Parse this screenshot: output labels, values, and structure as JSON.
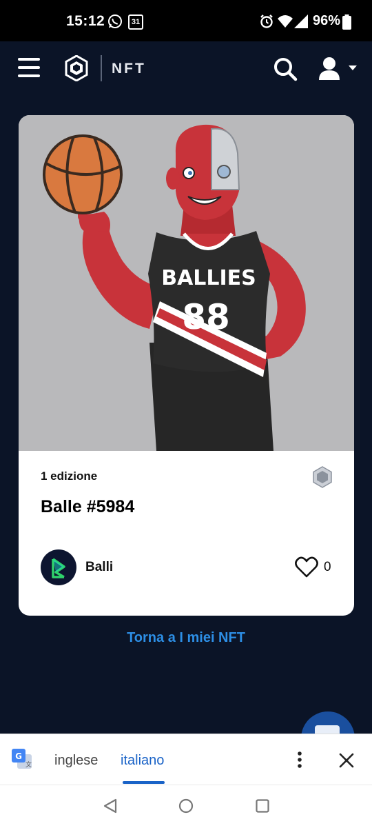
{
  "status_bar": {
    "time": "15:12",
    "calendar_day": "31",
    "battery": "96%"
  },
  "header": {
    "brand": "NFT",
    "icons": [
      "menu-icon",
      "crypto-com-logo",
      "search-icon",
      "account-icon",
      "caret-down-icon"
    ]
  },
  "nft": {
    "jersey_text": "BALLIES",
    "jersey_number": "88",
    "edition": "1 edizione",
    "title": "Balle #5984",
    "creator": "Balli",
    "likes": "0",
    "chain_icon": "hexagon-chain-icon"
  },
  "back_link": "Torna a I miei NFT",
  "translate_bar": {
    "source_lang": "inglese",
    "target_lang": "italiano",
    "selected": "italiano"
  },
  "colors": {
    "background": "#0b1427",
    "accent": "#2d8fe6",
    "translate_accent": "#1a63c7"
  }
}
